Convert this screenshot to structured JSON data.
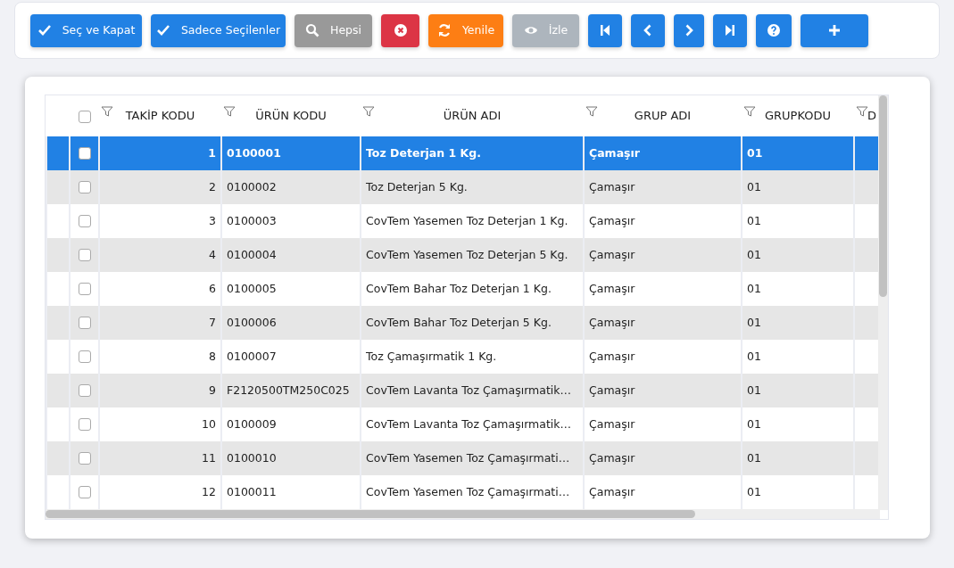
{
  "toolbar": {
    "buttons": [
      {
        "label": "Seç ve Kapat",
        "disabled": false
      },
      {
        "label": "Sadece Seçilenler",
        "disabled": false
      },
      {
        "label": "Hepsi",
        "disabled": false
      },
      {
        "disabled": false
      },
      {
        "label": "Yenile",
        "disabled": false
      },
      {
        "label": "İzle",
        "disabled": true
      },
      {
        "disabled": false
      },
      {
        "disabled": false
      },
      {
        "disabled": false
      },
      {
        "disabled": false
      },
      {
        "disabled": false
      },
      {
        "disabled": false
      }
    ]
  },
  "table": {
    "header_checkbox": {
      "checked": false
    },
    "columns": [
      {
        "label": "TAKİP KODU"
      },
      {
        "label": "ÜRÜN KODU"
      },
      {
        "label": "ÜRÜN ADI"
      },
      {
        "label": "GRUP ADI"
      },
      {
        "label": "GRUPKODU"
      },
      {
        "label": "D"
      }
    ],
    "rows": [
      {
        "selected": true,
        "checked": false,
        "cells": [
          "1",
          "0100001",
          "Toz Deterjan 1 Kg.",
          "Çamaşır",
          "01"
        ]
      },
      {
        "selected": false,
        "checked": false,
        "cells": [
          "2",
          "0100002",
          "Toz Deterjan 5 Kg.",
          "Çamaşır",
          "01"
        ]
      },
      {
        "selected": false,
        "checked": false,
        "cells": [
          "3",
          "0100003",
          "CovTem Yasemen Toz Deterjan 1 Kg.",
          "Çamaşır",
          "01"
        ]
      },
      {
        "selected": false,
        "checked": false,
        "cells": [
          "4",
          "0100004",
          "CovTem Yasemen Toz Deterjan 5 Kg.",
          "Çamaşır",
          "01"
        ]
      },
      {
        "selected": false,
        "checked": false,
        "cells": [
          "6",
          "0100005",
          "CovTem Bahar Toz Deterjan 1 Kg.",
          "Çamaşır",
          "01"
        ]
      },
      {
        "selected": false,
        "checked": false,
        "cells": [
          "7",
          "0100006",
          "CovTem Bahar Toz Deterjan 5 Kg.",
          "Çamaşır",
          "01"
        ]
      },
      {
        "selected": false,
        "checked": false,
        "cells": [
          "8",
          "0100007",
          "Toz Çamaşırmatik 1 Kg.",
          "Çamaşır",
          "01"
        ]
      },
      {
        "selected": false,
        "checked": false,
        "cells": [
          "9",
          "F2120500TM250C025",
          "CovTem Lavanta Toz Çamaşırmatik…",
          "Çamaşır",
          "01"
        ]
      },
      {
        "selected": false,
        "checked": false,
        "cells": [
          "10",
          "0100009",
          "CovTem Lavanta Toz Çamaşırmatik…",
          "Çamaşır",
          "01"
        ]
      },
      {
        "selected": false,
        "checked": false,
        "cells": [
          "11",
          "0100010",
          "CovTem Yasemen Toz Çamaşırmati…",
          "Çamaşır",
          "01"
        ]
      },
      {
        "selected": false,
        "checked": false,
        "cells": [
          "12",
          "0100011",
          "CovTem Yasemen Toz Çamaşırmati…",
          "Çamaşır",
          "01"
        ]
      }
    ]
  }
}
